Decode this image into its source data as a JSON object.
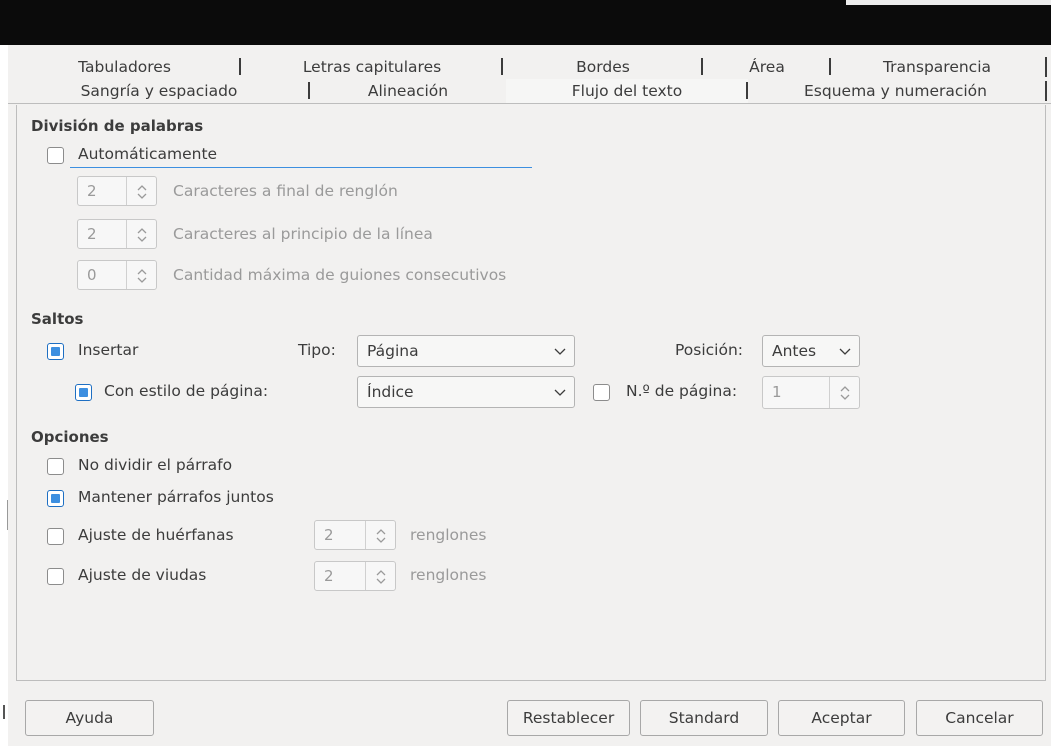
{
  "tabs_row1": [
    "Tabuladores",
    "Letras capitulares",
    "Bordes",
    "Área",
    "Transparencia"
  ],
  "tabs_row2": [
    "Sangría y espaciado",
    "Alineación",
    "Flujo del texto",
    "Esquema y numeración"
  ],
  "active_tab": "Flujo del texto",
  "hyphenation": {
    "title": "División de palabras",
    "auto_label": "Automáticamente",
    "auto_checked": false,
    "chars_end_value": "2",
    "chars_end_label": "Caracteres a final de renglón",
    "chars_start_value": "2",
    "chars_start_label": "Caracteres al principio de la línea",
    "max_hyphens_value": "0",
    "max_hyphens_label": "Cantidad máxima de guiones consecutivos"
  },
  "breaks": {
    "title": "Saltos",
    "insert_label": "Insertar",
    "insert_checked": true,
    "type_label": "Tipo:",
    "type_value": "Página",
    "position_label": "Posición:",
    "position_value": "Antes",
    "with_page_style_label": "Con estilo de página:",
    "with_page_style_checked": true,
    "page_style_value": "Índice",
    "page_number_label": "N.º de página:",
    "page_number_checked": false,
    "page_number_value": "1"
  },
  "options": {
    "title": "Opciones",
    "dont_split_label": "No dividir el párrafo",
    "dont_split_checked": false,
    "keep_together_label": "Mantener párrafos juntos",
    "keep_together_checked": true,
    "orphan_label": "Ajuste de huérfanas",
    "orphan_checked": false,
    "orphan_value": "2",
    "orphan_unit": "renglones",
    "widow_label": "Ajuste de viudas",
    "widow_checked": false,
    "widow_value": "2",
    "widow_unit": "renglones"
  },
  "buttons": {
    "help": "Ayuda",
    "reset": "Restablecer",
    "standard": "Standard",
    "ok": "Aceptar",
    "cancel": "Cancelar"
  },
  "colors": {
    "accent": "#3d8fe0",
    "dialog_bg": "#f2f1f0",
    "titlebar": "#0b0b0b"
  }
}
